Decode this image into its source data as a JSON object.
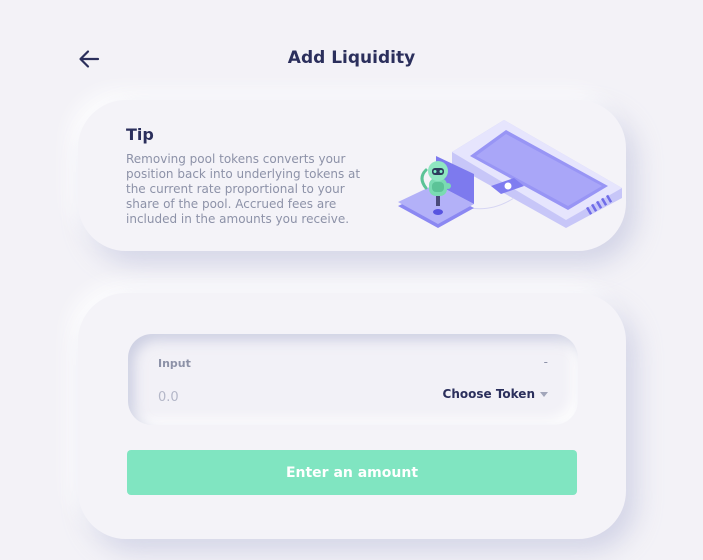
{
  "header": {
    "title": "Add Liquidity",
    "back_icon": "arrow-left-icon"
  },
  "tip": {
    "title": "Tip",
    "text": "Removing pool tokens converts your position back into underlying tokens at the current rate proportional to your share of the pool. Accrued fees are included in the amounts you receive.",
    "illustration": "laptop-robot-illustration"
  },
  "swap": {
    "input_label": "Input",
    "balance": "-",
    "amount_placeholder": "0.0",
    "token_select_label": "Choose Token",
    "token_select_icon": "chevron-down-icon",
    "submit_label": "Enter an amount"
  },
  "colors": {
    "background": "#f3f2f7",
    "title_text": "#2b2f5c",
    "muted_text": "#8d92a8",
    "button_green": "#80e5c1",
    "illustration_purple": "#9b98f6"
  }
}
